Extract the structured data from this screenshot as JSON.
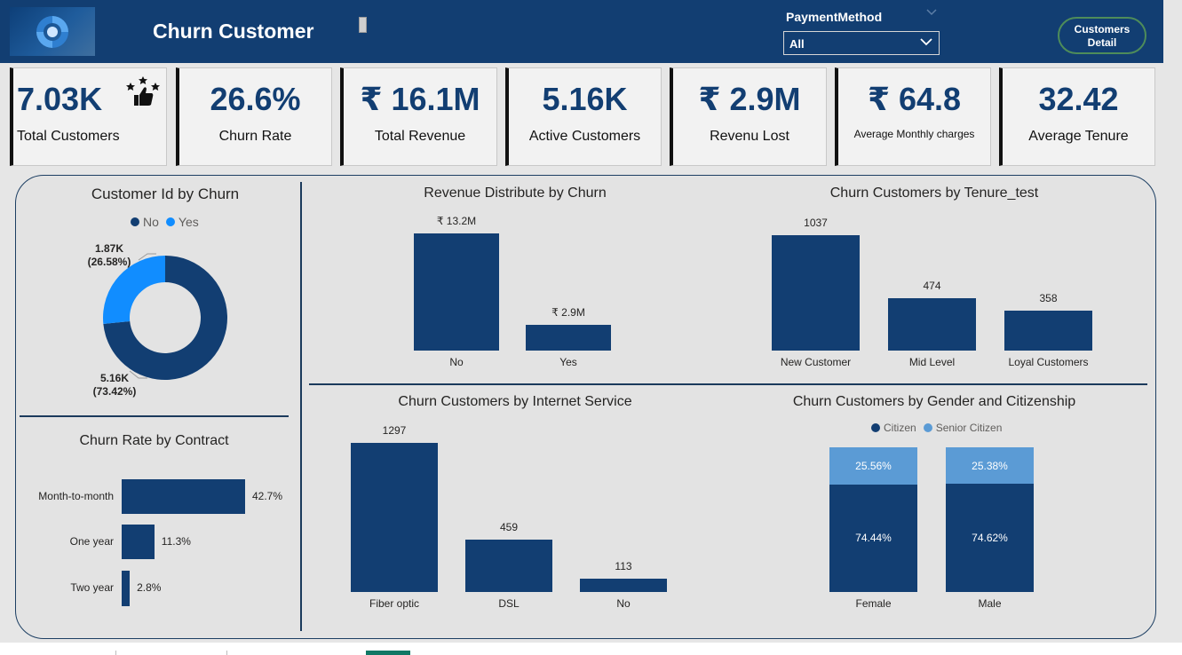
{
  "header": {
    "title": "Churn Customer",
    "slicer_label": "PaymentMethod",
    "slicer_value": "All",
    "button_label_line1": "Customers",
    "button_label_line2": "Detail"
  },
  "kpis": [
    {
      "value": "7.03K",
      "label": "Total Customers"
    },
    {
      "value": "26.6%",
      "label": "Churn Rate"
    },
    {
      "value": "₹ 16.1M",
      "label": "Total Revenue"
    },
    {
      "value": "5.16K",
      "label": "Active Customers"
    },
    {
      "value": "₹ 2.9M",
      "label": "Revenu Lost"
    },
    {
      "value": "₹ 64.8",
      "label": "Average Monthly charges"
    },
    {
      "value": "32.42",
      "label": "Average Tenure"
    }
  ],
  "colors": {
    "dark": "#123e72",
    "light": "#118dff",
    "citizen_light": "#5b9bd5"
  },
  "chart_data": [
    {
      "type": "pie",
      "title": "Customer Id by Churn",
      "legend": [
        "No",
        "Yes"
      ],
      "legend_position": "top",
      "slices": [
        {
          "name": "No",
          "value": 5.16,
          "label": "5.16K",
          "pct": "(73.42%)",
          "share": 73.42
        },
        {
          "name": "Yes",
          "value": 1.87,
          "label": "1.87K",
          "pct": "(26.58%)",
          "share": 26.58
        }
      ]
    },
    {
      "type": "bar",
      "orientation": "horizontal",
      "title": "Churn Rate by Contract",
      "categories": [
        "Month-to-month",
        "One year",
        "Two year"
      ],
      "values": [
        42.7,
        11.3,
        2.8
      ],
      "labels": [
        "42.7%",
        "11.3%",
        "2.8%"
      ]
    },
    {
      "type": "bar",
      "title": "Revenue Distribute by Churn",
      "categories": [
        "No",
        "Yes"
      ],
      "values": [
        13.2,
        2.9
      ],
      "labels": [
        "₹ 13.2M",
        "₹ 2.9M"
      ]
    },
    {
      "type": "bar",
      "title": "Churn Customers by Tenure_test",
      "categories": [
        "New Customer",
        "Mid Level",
        "Loyal Customers"
      ],
      "values": [
        1037,
        474,
        358
      ],
      "labels": [
        "1037",
        "474",
        "358"
      ]
    },
    {
      "type": "bar",
      "title": "Churn Customers by Internet Service",
      "categories": [
        "Fiber optic",
        "DSL",
        "No"
      ],
      "values": [
        1297,
        459,
        113
      ],
      "labels": [
        "1297",
        "459",
        "113"
      ]
    },
    {
      "type": "bar",
      "stacked": true,
      "percent": true,
      "title": "Churn Customers by Gender and Citizenship",
      "legend": [
        "Citizen",
        "Senior Citizen"
      ],
      "legend_position": "top",
      "categories": [
        "Female",
        "Male"
      ],
      "series": [
        {
          "name": "Citizen",
          "values": [
            74.44,
            74.62
          ],
          "labels": [
            "74.44%",
            "74.62%"
          ]
        },
        {
          "name": "Senior Citizen",
          "values": [
            25.56,
            25.38
          ],
          "labels": [
            "25.56%",
            "25.38%"
          ]
        }
      ]
    }
  ]
}
